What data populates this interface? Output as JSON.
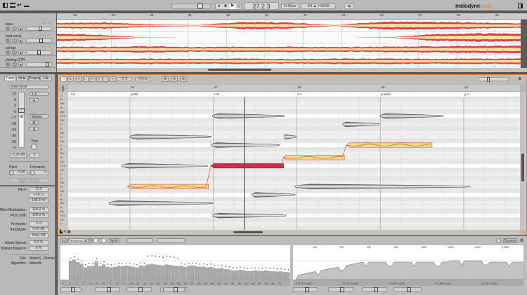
{
  "toolbar": {
    "position": "27.2.3",
    "key": "G Minor",
    "meter": "4/4",
    "tempo": "= 83.00",
    "logo_main": "melodyne",
    "logo_sub": "studio",
    "icons": [
      "layout-icon",
      "macro-icon",
      "note-assign-icon",
      "rhythm-icon"
    ]
  },
  "arrangement": {
    "bars": [
      "28",
      "29",
      "30",
      "31",
      "32",
      "33",
      "34",
      "35",
      "36",
      "37",
      "38",
      "39"
    ],
    "tracks": [
      {
        "name": "bass",
        "fader": 0.55
      },
      {
        "name": "lead vocal",
        "fader": 0.6
      },
      {
        "name": "strings",
        "fader": 0.5
      },
      {
        "name": "picking GTR",
        "fader": 0.9
      }
    ],
    "mute_label": "M",
    "solo_label": "S"
  },
  "inspector": {
    "tabs": [
      "Track",
      "Note",
      "Project",
      "File"
    ],
    "active_tab": "Track",
    "track_name": "lead vocal",
    "fader_scale": [
      "12",
      "6",
      "0",
      "-6",
      "-12",
      "-18",
      "-24",
      "-30",
      "-36",
      "-∞"
    ],
    "fader_level": 0.72,
    "routing": "1-2",
    "output": "Master",
    "mute": "M",
    "solo": "S",
    "gain": "-3.25 dB",
    "pan_label": "Pan",
    "pan": "0",
    "pitch_label": "Pitch",
    "pitch_value": "0.00",
    "formants_label": "Formants",
    "formants_value": "0",
    "apply": "Apply Offsets",
    "params": [
      {
        "label": "Pitch:",
        "value": "G 3"
      },
      {
        "label": "",
        "value": "+19 ct"
      },
      {
        "label": "",
        "value": "198.3 Hz"
      },
      {
        "label": "Pitch Modulation:",
        "value": "100.0 %"
      },
      {
        "label": "Pitch Drift:",
        "value": "100.0 %"
      },
      {
        "label": "Formants:",
        "value": "0 ct"
      },
      {
        "label": "Amplitude:",
        "value": "0.00 dB"
      },
      {
        "label": "",
        "value": "Note Off"
      },
      {
        "label": "Attack Speed:",
        "value": "0.0 %"
      },
      {
        "label": "Sibilant Balance:",
        "value": "0 %"
      }
    ],
    "file_label": "File:",
    "file": "MaterS...Domini",
    "algorithm_label": "Algorithm:",
    "algorithm": "Melodic"
  },
  "editor": {
    "pitch_field": "G 3",
    "cents_field": "+19 ct",
    "bars": [
      "26",
      "27",
      "28",
      "29",
      "30"
    ],
    "chords": [
      "C5",
      "g-/Bb",
      "c-/G",
      "d-7",
      "g-add4",
      "g-7"
    ],
    "pitch_labels": [
      "C",
      "B",
      "Bb",
      "A",
      "Ab",
      "G 4",
      "F#",
      "F",
      "E",
      "Eb",
      "D",
      "Db",
      "C",
      "B",
      "Bb",
      "A",
      "Ab",
      "G 3",
      "F#",
      "F",
      "E",
      "Eb",
      "D",
      "Db",
      "C",
      "B",
      "Bb",
      "A",
      "Ab",
      "G 2",
      "F#",
      "F"
    ],
    "playhead_bar": 27.37,
    "colors": {
      "selected_fill": "#c0304c",
      "edit_fill": "#f4dc86",
      "edit_stroke": "#d9414f",
      "note_gray": "#8a8a8a",
      "accent": "#e58a3c"
    },
    "notes": [
      {
        "pitch": "D4",
        "start": 26.0,
        "end": 26.97,
        "style": "gray"
      },
      {
        "pitch": "G3",
        "start": 25.9,
        "end": 26.93,
        "style": "gray"
      },
      {
        "pitch": "D3",
        "start": 25.97,
        "end": 26.94,
        "style": "edit"
      },
      {
        "pitch": "Bb2",
        "start": 25.75,
        "end": 26.99,
        "style": "gray"
      },
      {
        "pitch": "G4",
        "start": 26.99,
        "end": 27.85,
        "style": "gray"
      },
      {
        "pitch": "C4",
        "start": 26.97,
        "end": 27.79,
        "style": "gray"
      },
      {
        "pitch": "G3",
        "start": 26.97,
        "end": 27.84,
        "style": "selected"
      },
      {
        "pitch": "G2",
        "start": 26.99,
        "end": 27.87,
        "style": "gray"
      },
      {
        "pitch": "C3",
        "start": 27.46,
        "end": 27.98,
        "style": "gray"
      },
      {
        "pitch": "A3",
        "start": 27.84,
        "end": 28.57,
        "style": "edit"
      },
      {
        "pitch": "D4",
        "start": 27.85,
        "end": 27.99,
        "style": "gray"
      },
      {
        "pitch": "F4",
        "start": 28.55,
        "end": 28.99,
        "style": "gray"
      },
      {
        "pitch": "C4",
        "start": 28.59,
        "end": 29.62,
        "style": "edit"
      },
      {
        "pitch": "G4",
        "start": 29.0,
        "end": 29.75,
        "style": "gray"
      },
      {
        "pitch": "D3",
        "start": 27.98,
        "end": 30.08,
        "style": "gray"
      }
    ]
  },
  "sound_editor": {
    "tabs": [
      "Lo",
      "Harmonics",
      "Hi",
      "EQ",
      "Synth"
    ],
    "active_tab": "Harmonics",
    "bypass": "Bypass",
    "harmonic_labels": [
      "+",
      "1",
      "2",
      "3",
      "4",
      "5",
      "6",
      "7",
      "8",
      "9",
      "10",
      "11",
      "12",
      "13",
      "14",
      "15",
      "16",
      "18",
      "20",
      "22",
      "24",
      "26",
      "28",
      "30",
      "32",
      "36",
      "40",
      "44",
      "48",
      "52",
      "56",
      "60",
      "72"
    ],
    "harmonic_levels": [
      0.62,
      0.66,
      0.58,
      0.52,
      0.4,
      0.44,
      0.45,
      0.6,
      0.44,
      0.5,
      0.42,
      0.4,
      0.42,
      0.45,
      0.44,
      0.46,
      0.45,
      0.42,
      0.4,
      0.46,
      0.45,
      0.5,
      0.52,
      0.5,
      0.48,
      0.46,
      0.5,
      0.48,
      0.46,
      0.44,
      0.46,
      0.42,
      0.45,
      0.46,
      0.44,
      0.42,
      0.43,
      0.4,
      0.42,
      0.38,
      0.36,
      0.38,
      0.34,
      0.33,
      0.3,
      0.3,
      0.32,
      0.3,
      0.28,
      0.28,
      0.3,
      0.29,
      0.28,
      0.3,
      0.28,
      0.27,
      0.26,
      0.27,
      0.25,
      0.24
    ],
    "freq_labels": [
      "100",
      "200",
      "400",
      "800",
      "1600",
      "3200",
      "6400",
      "12800"
    ],
    "note_axis": "C D EF G A BC",
    "page": "1",
    "page_next": "3"
  }
}
